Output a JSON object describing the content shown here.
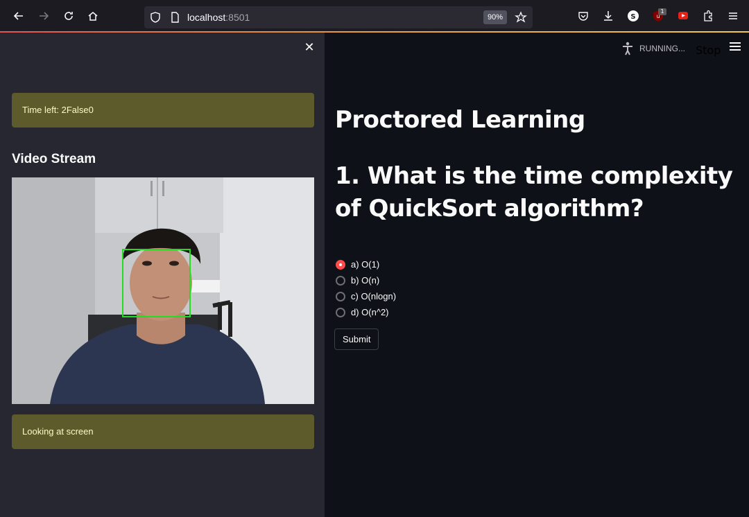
{
  "browser": {
    "url_host": "localhost",
    "url_port": ":8501",
    "zoom": "90%",
    "extension_badge": "1"
  },
  "sidebar": {
    "time_left": "Time left: 2False0",
    "video_heading": "Video Stream",
    "gaze_status": "Looking at screen"
  },
  "header": {
    "status": "RUNNING...",
    "stop_label": "Stop"
  },
  "main": {
    "title": "Proctored Learning",
    "question": "1. What is the time complexity of QuickSort algorithm?",
    "options": [
      {
        "label": "a) O(1)",
        "selected": true
      },
      {
        "label": "b) O(n)",
        "selected": false
      },
      {
        "label": "c) O(nlogn)",
        "selected": false
      },
      {
        "label": "d) O(n^2)",
        "selected": false
      }
    ],
    "submit_label": "Submit"
  },
  "colors": {
    "accent": "#ff4b4b",
    "alert_bg": "#5d5a2c",
    "face_box": "#22dd22"
  }
}
